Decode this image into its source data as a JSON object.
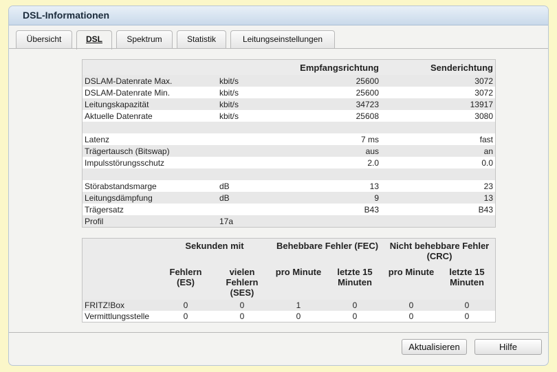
{
  "window": {
    "title": "DSL-Informationen"
  },
  "tabs": [
    {
      "label": "Übersicht"
    },
    {
      "label": "DSL"
    },
    {
      "label": "Spektrum"
    },
    {
      "label": "Statistik"
    },
    {
      "label": "Leitungseinstellungen"
    }
  ],
  "info": {
    "headers": [
      "",
      "",
      "Empfangsrichtung",
      "Senderichtung"
    ],
    "rows": [
      {
        "label": "DSLAM-Datenrate Max.",
        "unit": "kbit/s",
        "down": "25600",
        "up": "3072"
      },
      {
        "label": "DSLAM-Datenrate Min.",
        "unit": "kbit/s",
        "down": "25600",
        "up": "3072"
      },
      {
        "label": "Leitungskapazität",
        "unit": "kbit/s",
        "down": "34723",
        "up": "13917"
      },
      {
        "label": "Aktuelle Datenrate",
        "unit": "kbit/s",
        "down": "25608",
        "up": "3080"
      },
      {
        "label": "",
        "unit": "",
        "down": "",
        "up": ""
      },
      {
        "label": "Latenz",
        "unit": "",
        "down": "7 ms",
        "up": "fast"
      },
      {
        "label": "Trägertausch (Bitswap)",
        "unit": "",
        "down": "aus",
        "up": "an"
      },
      {
        "label": "Impulsstörungsschutz",
        "unit": "",
        "down": "2.0",
        "up": "0.0"
      },
      {
        "label": "",
        "unit": "",
        "down": "",
        "up": ""
      },
      {
        "label": "Störabstandsmarge",
        "unit": "dB",
        "down": "13",
        "up": "23"
      },
      {
        "label": "Leitungsdämpfung",
        "unit": "dB",
        "down": "9",
        "up": "13"
      },
      {
        "label": "Trägersatz",
        "unit": "",
        "down": "B43",
        "up": "B43"
      },
      {
        "label": "Profil",
        "unit": "17a",
        "down": "",
        "up": ""
      }
    ]
  },
  "errors": {
    "groups": [
      "Sekunden mit",
      "Behebbare Fehler (FEC)",
      "Nicht behebbare Fehler (CRC)"
    ],
    "columns": [
      "Fehlern (ES)",
      "vielen Fehlern (SES)",
      "pro Minute",
      "letzte 15 Minuten",
      "pro Minute",
      "letzte 15 Minuten"
    ],
    "rows": [
      {
        "label": "FRITZ!Box",
        "values": [
          "0",
          "0",
          "1",
          "0",
          "0",
          "0"
        ]
      },
      {
        "label": "Vermittlungsstelle",
        "values": [
          "0",
          "0",
          "0",
          "0",
          "0",
          "0"
        ]
      }
    ]
  },
  "buttons": {
    "refresh": "Aktualisieren",
    "help": "Hilfe"
  }
}
